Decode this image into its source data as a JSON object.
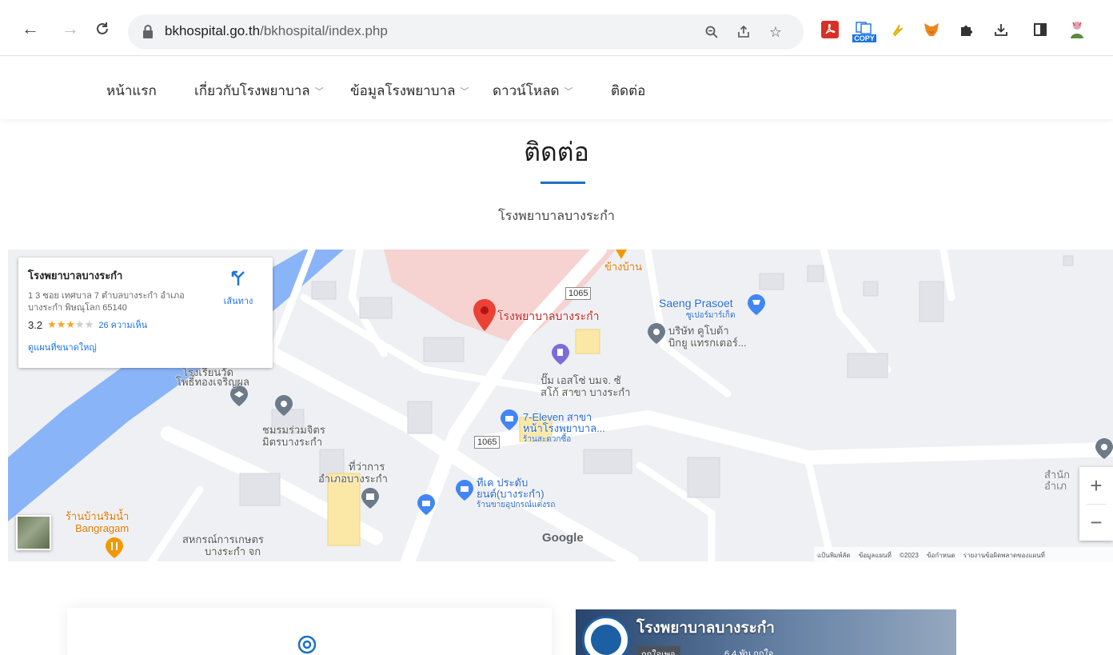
{
  "browser": {
    "url_domain": "bkhospital.go.th",
    "url_path": "/bkhospital/index.php",
    "extension_copy_label": "COPY"
  },
  "site_nav": {
    "items": [
      {
        "label": "หน้าแรก"
      },
      {
        "label": "เกี่ยวกับโรงพยาบาล"
      },
      {
        "label": "ข้อมูลโรงพยาบาล"
      },
      {
        "label": "ดาวน์โหลด"
      },
      {
        "label": "ติดต่อ"
      }
    ]
  },
  "page": {
    "title": "ติดต่อ",
    "subtitle": "โรงพยาบาลบางระกำ",
    "accent_color": "#1a72c2"
  },
  "map": {
    "info_card": {
      "name": "โรงพยาบาลบางระกำ",
      "address": "1 3 ซอย เทศบาล 7 ตำบลบางระกำ อำเภอบางระกำ พิษณุโลก 65140",
      "rating": "3.2",
      "stars_on": "★★★",
      "stars_off": "★★",
      "reviews": "26 ความเห็น",
      "larger_map": "ดูแผนที่ขนาดใหญ่",
      "directions": "เส้นทาง"
    },
    "labels": {
      "khang_ban": "ข้างบ้าน",
      "hospital": "โรงพยาบาลบางระกำ",
      "saeng_prasoet": "Saeng Prasoet",
      "saeng_sub": "ซูเปอร์มาร์เก็ต",
      "kubota_1": "บริษัท คูโบต้า",
      "kubota_2": "บิกยู แทรกเตอร์...",
      "road_1065_a": "1065",
      "road_1065_b": "1065",
      "school_1": "โรงเรียนวัด",
      "school_2": "โพธิ์ทองเจริญผล",
      "club_1": "ชมรมร่วมจิตร",
      "club_2": "มิตรบางระกำ",
      "pump_1": "ปั๊ม เอสโซ่ บมจ. ซั",
      "pump_2": "สโก้ สาขา บางระกำ",
      "seven_1": "7-Eleven สาขา",
      "seven_2": "หน้าโรงพยาบาล...",
      "seven_3": "ร้านสะดวกซื้อ",
      "district_1": "ที่ว่าการ",
      "district_2": "อำเภอบางระกำ",
      "tire_1": "ทีเค ประดับ",
      "tire_2": "ยนต์(บางระกำ)",
      "tire_3": "ร้านขายอุปกรณ์แต่งรถ",
      "restaurant_1": "ร้านบ้านริมน้ำ",
      "restaurant_2": "Bangragam",
      "coop_1": "สหกรณ์การเกษตร",
      "coop_2": "บางระกำ จก",
      "office_1": "สำนัก",
      "office_2": "อำเภ"
    },
    "google_label": "Google",
    "footer": "แป้นพิมพ์ลัด ข้อมูลแผนที่ ©2023 ข้อกำหนด รายงานข้อผิดพลาดของแผนที่",
    "zoom_in": "+",
    "zoom_out": "−"
  },
  "facebook_box": {
    "title": "โรงพยาบาลบางระกำ",
    "like": "ถูกใจเพจ",
    "count": "6.4 พัน ถูกใจ"
  }
}
